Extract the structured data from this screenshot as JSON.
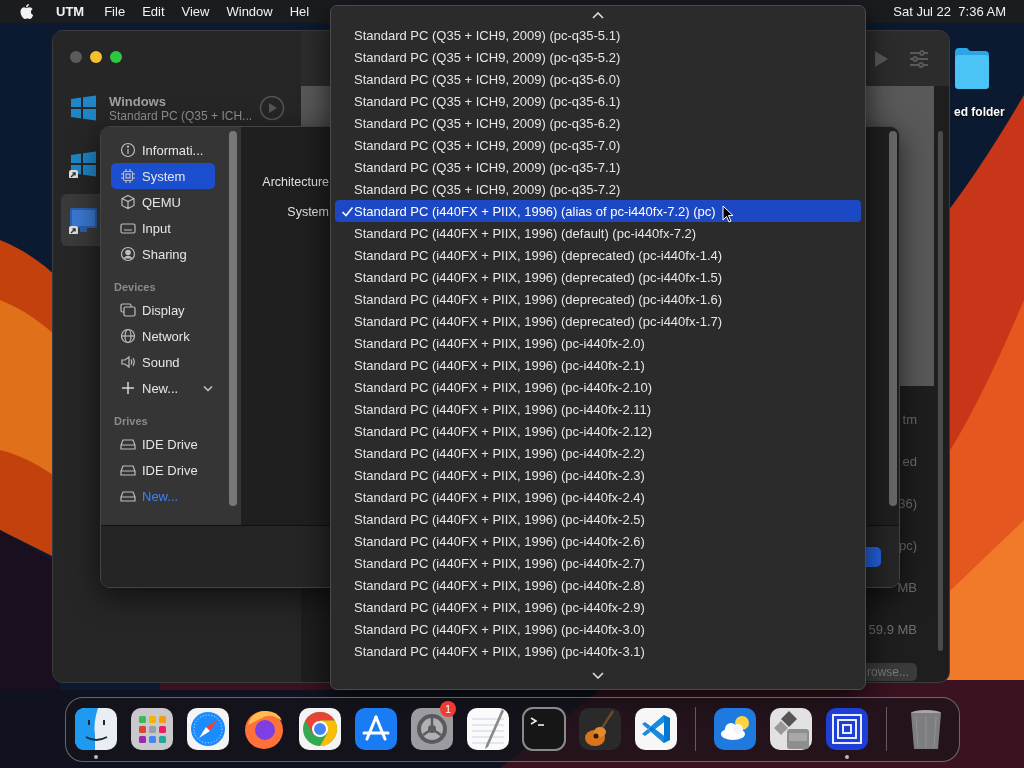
{
  "menu_bar": {
    "app_name": "UTM",
    "menus": [
      "File",
      "Edit",
      "View",
      "Window",
      "Hel"
    ],
    "clock": "Sat Jul 22  7:36 AM"
  },
  "desktop": {
    "folder_label": "ed folder"
  },
  "vm_window": {
    "vms": [
      {
        "kind": "windows",
        "name": "Windows",
        "subtitle": "Standard PC (Q35 + ICH...",
        "selected": false
      },
      {
        "kind": "windows-shortcut",
        "selected": false
      },
      {
        "kind": "display-shortcut",
        "selected": true
      }
    ],
    "details": [
      "tm",
      "ed",
      "36)",
      "pc)",
      "MB",
      "59.9 MB"
    ],
    "browse_button": "rowse..."
  },
  "settings": {
    "sections": [
      {
        "items": [
          {
            "kind": "info",
            "label": "Informati...",
            "selected": false
          },
          {
            "kind": "chip",
            "label": "System",
            "selected": true
          },
          {
            "kind": "cube",
            "label": "QEMU",
            "selected": false
          },
          {
            "kind": "keyboard",
            "label": "Input",
            "selected": false
          },
          {
            "kind": "person",
            "label": "Sharing",
            "selected": false
          }
        ]
      },
      {
        "header": "Devices",
        "items": [
          {
            "kind": "display",
            "label": "Display",
            "selected": false
          },
          {
            "kind": "globe",
            "label": "Network",
            "selected": false
          },
          {
            "kind": "speaker",
            "label": "Sound",
            "selected": false
          },
          {
            "kind": "add",
            "label": "New...",
            "selected": false
          }
        ]
      },
      {
        "header": "Drives",
        "items": [
          {
            "kind": "drive",
            "label": "IDE Drive",
            "selected": false
          },
          {
            "kind": "drive",
            "label": "IDE Drive",
            "selected": false
          },
          {
            "kind": "new-drive",
            "label": "New...",
            "selected": false
          }
        ]
      }
    ],
    "form": [
      "Architecture",
      "System"
    ]
  },
  "dropdown": {
    "items": [
      {
        "label": "Standard PC (Q35 + ICH9, 2009) (pc-q35-5.1)",
        "checked": false,
        "selected": false
      },
      {
        "label": "Standard PC (Q35 + ICH9, 2009) (pc-q35-5.2)",
        "checked": false,
        "selected": false
      },
      {
        "label": "Standard PC (Q35 + ICH9, 2009) (pc-q35-6.0)",
        "checked": false,
        "selected": false
      },
      {
        "label": "Standard PC (Q35 + ICH9, 2009) (pc-q35-6.1)",
        "checked": false,
        "selected": false
      },
      {
        "label": "Standard PC (Q35 + ICH9, 2009) (pc-q35-6.2)",
        "checked": false,
        "selected": false
      },
      {
        "label": "Standard PC (Q35 + ICH9, 2009) (pc-q35-7.0)",
        "checked": false,
        "selected": false
      },
      {
        "label": "Standard PC (Q35 + ICH9, 2009) (pc-q35-7.1)",
        "checked": false,
        "selected": false
      },
      {
        "label": "Standard PC (Q35 + ICH9, 2009) (pc-q35-7.2)",
        "checked": false,
        "selected": false
      },
      {
        "label": "Standard PC (i440FX + PIIX, 1996) (alias of pc-i440fx-7.2) (pc)",
        "checked": true,
        "selected": true
      },
      {
        "label": "Standard PC (i440FX + PIIX, 1996) (default) (pc-i440fx-7.2)",
        "checked": false,
        "selected": false
      },
      {
        "label": "Standard PC (i440FX + PIIX, 1996) (deprecated) (pc-i440fx-1.4)",
        "checked": false,
        "selected": false
      },
      {
        "label": "Standard PC (i440FX + PIIX, 1996) (deprecated) (pc-i440fx-1.5)",
        "checked": false,
        "selected": false
      },
      {
        "label": "Standard PC (i440FX + PIIX, 1996) (deprecated) (pc-i440fx-1.6)",
        "checked": false,
        "selected": false
      },
      {
        "label": "Standard PC (i440FX + PIIX, 1996) (deprecated) (pc-i440fx-1.7)",
        "checked": false,
        "selected": false
      },
      {
        "label": "Standard PC (i440FX + PIIX, 1996) (pc-i440fx-2.0)",
        "checked": false,
        "selected": false
      },
      {
        "label": "Standard PC (i440FX + PIIX, 1996) (pc-i440fx-2.1)",
        "checked": false,
        "selected": false
      },
      {
        "label": "Standard PC (i440FX + PIIX, 1996) (pc-i440fx-2.10)",
        "checked": false,
        "selected": false
      },
      {
        "label": "Standard PC (i440FX + PIIX, 1996) (pc-i440fx-2.11)",
        "checked": false,
        "selected": false
      },
      {
        "label": "Standard PC (i440FX + PIIX, 1996) (pc-i440fx-2.12)",
        "checked": false,
        "selected": false
      },
      {
        "label": "Standard PC (i440FX + PIIX, 1996) (pc-i440fx-2.2)",
        "checked": false,
        "selected": false
      },
      {
        "label": "Standard PC (i440FX + PIIX, 1996) (pc-i440fx-2.3)",
        "checked": false,
        "selected": false
      },
      {
        "label": "Standard PC (i440FX + PIIX, 1996) (pc-i440fx-2.4)",
        "checked": false,
        "selected": false
      },
      {
        "label": "Standard PC (i440FX + PIIX, 1996) (pc-i440fx-2.5)",
        "checked": false,
        "selected": false
      },
      {
        "label": "Standard PC (i440FX + PIIX, 1996) (pc-i440fx-2.6)",
        "checked": false,
        "selected": false
      },
      {
        "label": "Standard PC (i440FX + PIIX, 1996) (pc-i440fx-2.7)",
        "checked": false,
        "selected": false
      },
      {
        "label": "Standard PC (i440FX + PIIX, 1996) (pc-i440fx-2.8)",
        "checked": false,
        "selected": false
      },
      {
        "label": "Standard PC (i440FX + PIIX, 1996) (pc-i440fx-2.9)",
        "checked": false,
        "selected": false
      },
      {
        "label": "Standard PC (i440FX + PIIX, 1996) (pc-i440fx-3.0)",
        "checked": false,
        "selected": false
      },
      {
        "label": "Standard PC (i440FX + PIIX, 1996) (pc-i440fx-3.1)",
        "checked": false,
        "selected": false
      }
    ]
  },
  "dock": {
    "sections": [
      {
        "apps": [
          {
            "kind": "finder",
            "running": true
          },
          {
            "kind": "launchpad",
            "running": false
          },
          {
            "kind": "compass",
            "running": false
          },
          {
            "kind": "fox",
            "running": false
          },
          {
            "kind": "chrome",
            "running": false
          },
          {
            "kind": "store",
            "running": false
          },
          {
            "kind": "gear",
            "running": false,
            "badge": "1"
          },
          {
            "kind": "notepad",
            "running": false
          },
          {
            "kind": "terminal",
            "running": false
          },
          {
            "kind": "guitar",
            "running": false
          },
          {
            "kind": "code",
            "running": false
          }
        ]
      },
      {
        "apps": [
          {
            "kind": "weather",
            "running": false
          },
          {
            "kind": "disk",
            "running": false
          },
          {
            "kind": "squares",
            "running": true
          }
        ]
      },
      {
        "apps": [
          {
            "kind": "trash",
            "running": false
          }
        ]
      }
    ]
  }
}
